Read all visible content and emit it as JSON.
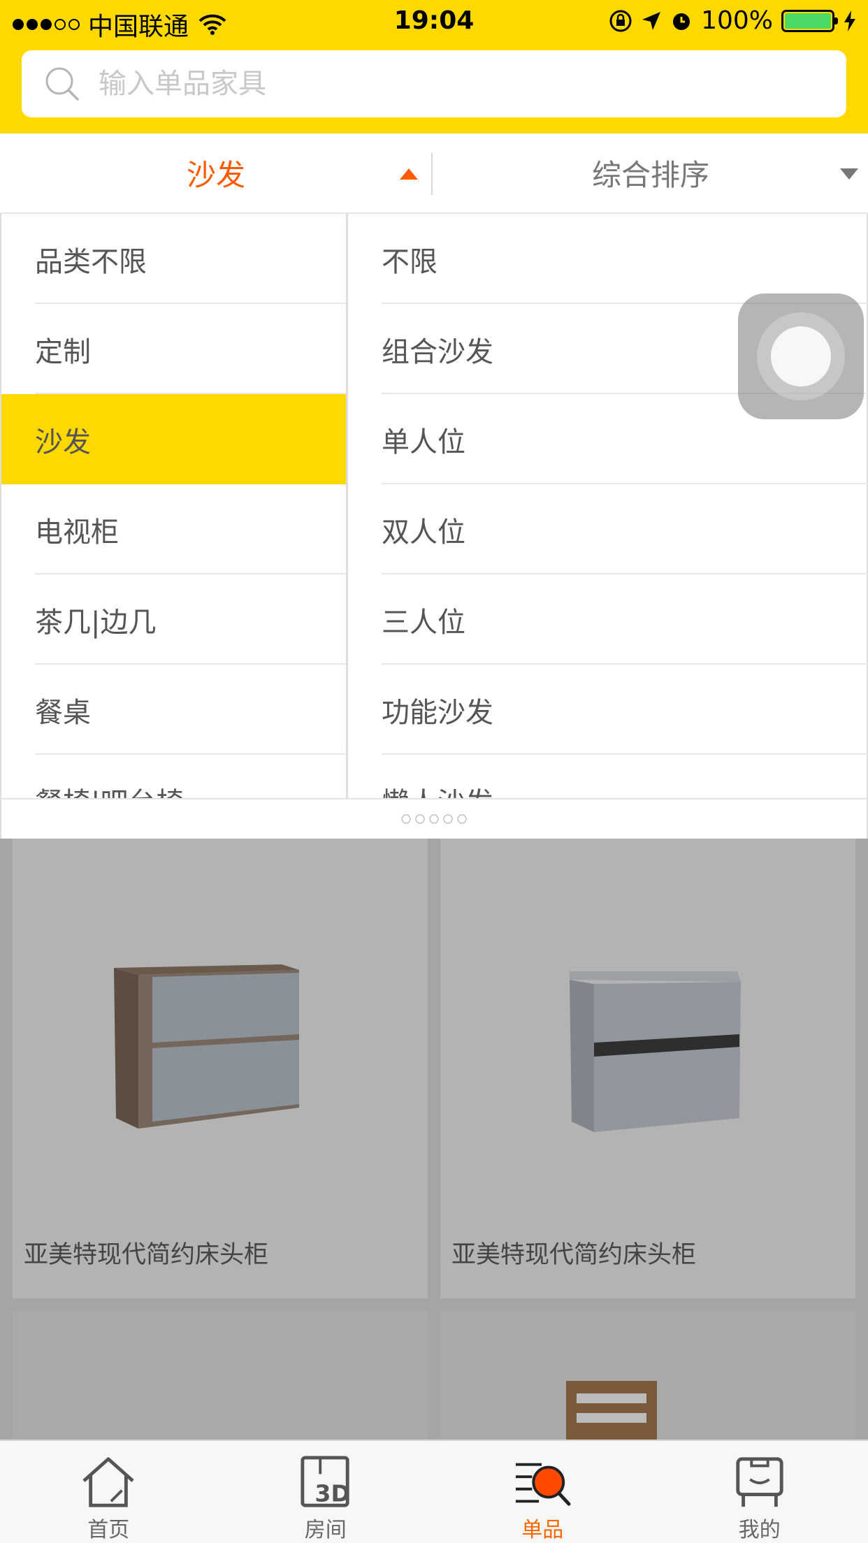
{
  "status_bar": {
    "carrier": "中国联通",
    "time": "19:04",
    "battery": "100%",
    "signal_strength": 3
  },
  "search": {
    "placeholder": "输入单品家具"
  },
  "filter": {
    "category_label": "沙发",
    "sort_label": "综合排序"
  },
  "categories": [
    {
      "label": "品类不限"
    },
    {
      "label": "定制"
    },
    {
      "label": "沙发",
      "selected": true
    },
    {
      "label": "电视柜"
    },
    {
      "label": "茶几|边几"
    },
    {
      "label": "餐桌"
    },
    {
      "label": "餐椅|吧台椅"
    }
  ],
  "subcategories": [
    {
      "label": "不限"
    },
    {
      "label": "组合沙发"
    },
    {
      "label": "单人位"
    },
    {
      "label": "双人位"
    },
    {
      "label": "三人位"
    },
    {
      "label": "功能沙发"
    },
    {
      "label": "懒人沙发"
    }
  ],
  "products": [
    {
      "title": "亚美特现代简约床头柜"
    },
    {
      "title": "亚美特现代简约床头柜"
    }
  ],
  "tabbar": [
    {
      "label": "首页",
      "icon": "home-icon"
    },
    {
      "label": "房间",
      "icon": "room-3d-icon"
    },
    {
      "label": "单品",
      "icon": "items-icon",
      "active": true
    },
    {
      "label": "我的",
      "icon": "profile-icon"
    }
  ],
  "colors": {
    "brand_yellow": "#FFD800",
    "accent_orange": "#FF5A00",
    "tab_active": "#FF6600"
  }
}
